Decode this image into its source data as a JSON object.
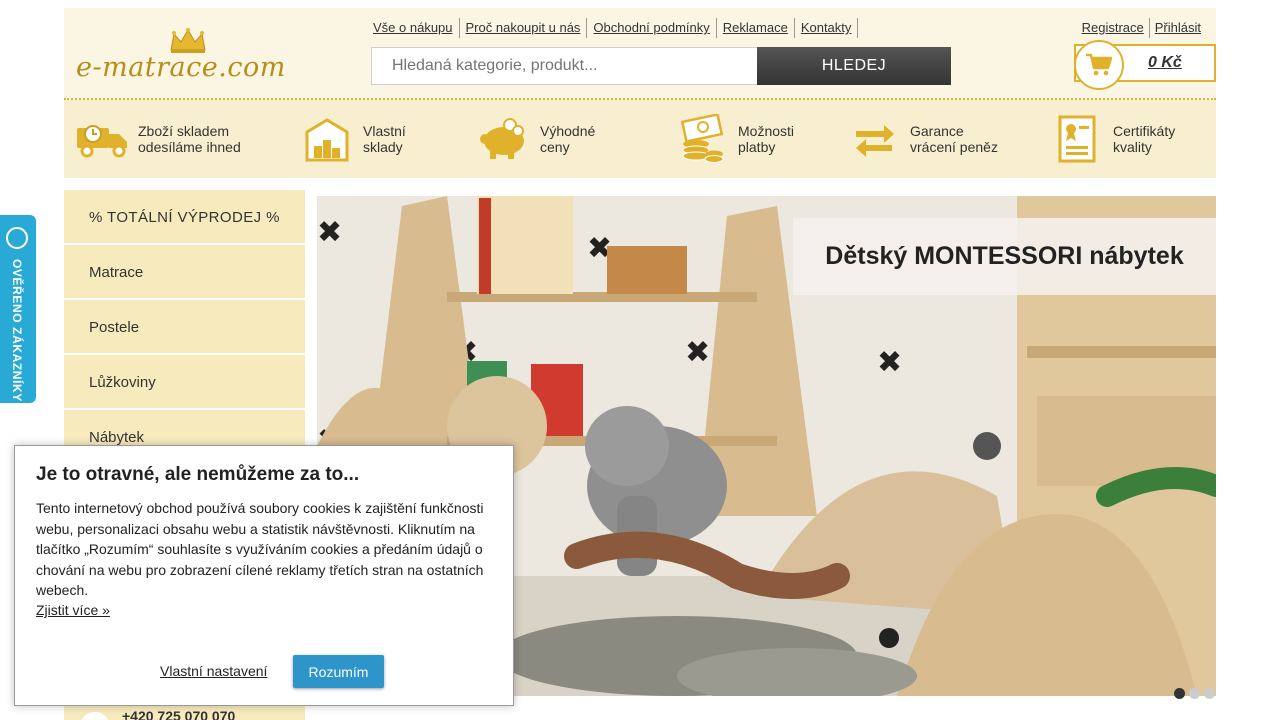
{
  "header": {
    "logo_text": "e-matrace.com",
    "nav": [
      "Vše o nákupu",
      "Proč nakoupit u nás",
      "Obchodní podmínky",
      "Reklamace",
      "Kontakty"
    ],
    "search_placeholder": "Hledaná kategorie, produkt...",
    "search_button": "HLEDEJ",
    "account_links": [
      "Registrace",
      "Přihlásit"
    ],
    "cart_total": "0 Kč"
  },
  "benefits": [
    {
      "text": "Zboží skladem\nodesíláme ihned",
      "icon": "delivery-truck-icon"
    },
    {
      "text": "Vlastní\nsklady",
      "icon": "warehouse-icon"
    },
    {
      "text": "Výhodné\nceny",
      "icon": "piggy-bank-icon"
    },
    {
      "text": "Možnosti\nplatby",
      "icon": "banknotes-coins-icon"
    },
    {
      "text": "Garance\nvrácení peněz",
      "icon": "exchange-arrows-icon"
    },
    {
      "text": "Certifikáty\nkvality",
      "icon": "certificate-icon"
    }
  ],
  "sidebar": {
    "items": [
      "% TOTÁLNÍ VÝPRODEJ %",
      "Matrace",
      "Postele",
      "Lůžkoviny",
      "Nábytek"
    ],
    "phone": "+420 725 070 070"
  },
  "banner": {
    "caption": "Dětský MONTESSORI nábytek",
    "slide_count": 3,
    "active_slide": 1
  },
  "verified_tab": {
    "label": "OVĚŘENO ZÁKAZNÍKY"
  },
  "cookie": {
    "title": "Je to otravné, ale nemůžeme za to...",
    "text": "Tento internetový obchod používá soubory cookies k zajištění funkčnosti webu, personalizaci obsahu webu a statistik návštěvnosti. Kliknutím na tlačítko „Rozumím“ souhlasíte s využíváním cookies a předáním údajů o chování na webu pro zobrazení cílené reklamy třetích stran na ostatních webech.",
    "more_link": "Zjistit více »",
    "settings_link": "Vlastní nastavení",
    "accept_button": "Rozumím"
  },
  "colors": {
    "gold": "#e0b22b",
    "cream": "#f7efcf",
    "sidebar": "#f7ebbe",
    "accent_blue": "#2d95c9",
    "verified_blue": "#29a9d6"
  }
}
